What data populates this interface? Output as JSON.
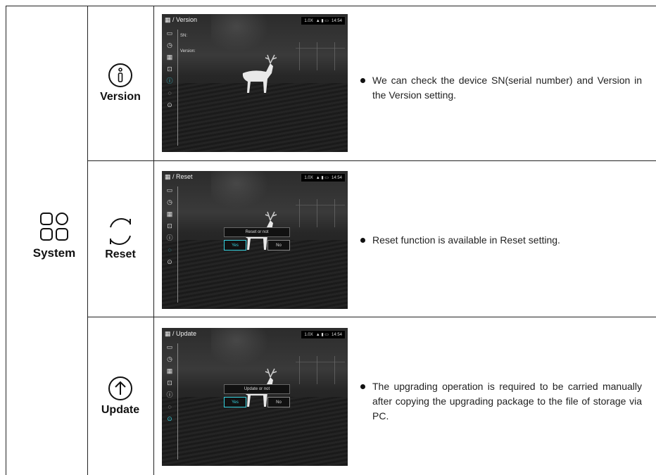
{
  "category": {
    "label": "System",
    "icon": "system-grid-icon"
  },
  "rows": [
    {
      "id": "version",
      "label": "Version",
      "icon": "info-circle-icon",
      "screen": {
        "title": "/ Version",
        "status": {
          "zoom": "1.0X",
          "time": "14:54"
        },
        "fields": [
          "SN:",
          "Version:"
        ]
      },
      "description": "We can check the device SN(serial number) and Version in the Version setting."
    },
    {
      "id": "reset",
      "label": "Reset",
      "icon": "reset-arrows-icon",
      "screen": {
        "title": "/ Reset",
        "status": {
          "zoom": "1.0X",
          "time": "14:54"
        },
        "dialog": {
          "question": "Reset or not",
          "yes": "Yes",
          "no": "No"
        }
      },
      "description": "Reset function is available in Reset setting."
    },
    {
      "id": "update",
      "label": "Update",
      "icon": "upload-arrow-icon",
      "screen": {
        "title": "/ Update",
        "status": {
          "zoom": "1.0X",
          "time": "14:54"
        },
        "dialog": {
          "question": "Update or not",
          "yes": "Yes",
          "no": "No"
        }
      },
      "description": "The upgrading operation is required to be carried manually after copying the upgrading package to the file of storage via PC."
    }
  ],
  "menu_icons": [
    "display-icon",
    "clock-icon",
    "calendar-icon",
    "download-icon",
    "info-icon",
    "reset-icon",
    "update-icon"
  ],
  "accent": "#36d3e0"
}
